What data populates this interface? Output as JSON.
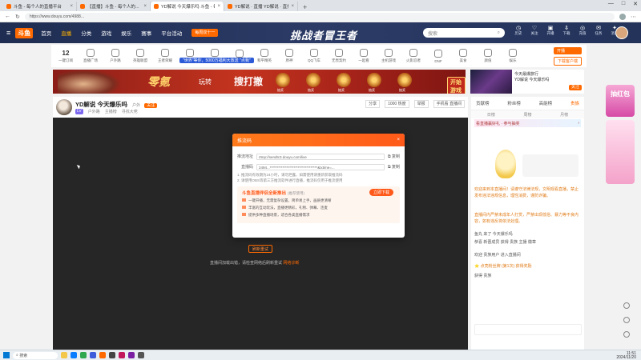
{
  "browser": {
    "tabs": [
      {
        "title": "斗鱼 - 每个人的直播平台",
        "active": false
      },
      {
        "title": "【直播】斗鱼 - 每个人的...",
        "active": false
      },
      {
        "title": "YD解说 今天爆乐吗 斗鱼 - 每个人...",
        "active": true
      },
      {
        "title": "YD解说 · 直播 YD解说 · 直播",
        "active": false
      }
    ],
    "url": "https://www.douyu.com/4988...",
    "window_controls": [
      "—",
      "□",
      "✕"
    ]
  },
  "site": {
    "logo": "斗鱼",
    "nav": [
      "首页",
      "直播",
      "分类",
      "游戏",
      "娱乐",
      "赛事",
      "平台活动"
    ],
    "promo_badge": "每周双十一",
    "slogan": "挑战者冒王者",
    "search_placeholder": "搜索",
    "header_icons": [
      {
        "label": "历史",
        "glyph": "◷"
      },
      {
        "label": "关注",
        "glyph": "♡"
      },
      {
        "label": "开播",
        "glyph": "▣"
      },
      {
        "label": "下载",
        "glyph": "⇩"
      },
      {
        "label": "充值",
        "glyph": "◎"
      },
      {
        "label": "任务",
        "glyph": "✉"
      },
      {
        "label": "消息",
        "glyph": "✦"
      }
    ]
  },
  "category_bar": {
    "number_item": {
      "value": "12",
      "label": "一键订阅"
    },
    "items": [
      "直播广场",
      "户外路",
      "英雄联盟",
      "王者荣耀",
      "穿越火线",
      "绝地求生",
      "CS2",
      "和平精英",
      "原神",
      "QQ飞车",
      "无畏契约",
      "一起看",
      "主机游戏",
      "火影忍者",
      "DNF",
      "美食",
      "颜值",
      "娱乐"
    ],
    "announcement": "\"世界\"等你，5000万福利大放送 \"点我\"",
    "right_buttons": [
      "开播",
      "下载客户端"
    ]
  },
  "banner": {
    "headline": "零氪",
    "middle": "玩转",
    "slogan": "搜打撤",
    "play_button": "开始游戏",
    "gift_labels": [
      "抽奖",
      "抽奖",
      "抽奖",
      "抽奖",
      "抽奖"
    ],
    "right_ad": {
      "title": "今天最爆旅行",
      "subtitle": "YD解说 今天爆乐吗",
      "follow": "关注"
    }
  },
  "room": {
    "title": "YD解说 今天爆乐吗",
    "tag": "户外",
    "follow": "关注",
    "level": "LV",
    "meta": [
      "户外路",
      "主播榜",
      "寻找大佬"
    ],
    "right": [
      "分享",
      "1000 热度",
      "举报",
      "手机看 直播间"
    ]
  },
  "player": {
    "error_button": "刷新重试",
    "error_text": "直播间加载出错，请检查网络后刷新重试",
    "error_link": "网络诊断"
  },
  "sidebar": {
    "tabs": [
      "贡献榜",
      "粉丝榜",
      "高能榜",
      "贵族"
    ],
    "active_tab": 3,
    "subtabs": [
      "日榜",
      "周榜",
      "月榜"
    ],
    "promo_text": "看直播赢好礼 · 参与抽奖",
    "messages": [
      {
        "text": "欢迎来到本直播间！请遵守法律法规，文明观看直播，禁止发布违法违规信息，理性消费，谨防诈骗。",
        "color": "orange"
      },
      {
        "text": "直播间内严禁未成年人打赏，严禁出现低俗、暴力等不良内容，如有违反将依法处理。",
        "color": "orange"
      },
      {
        "text": "鱼丸 来了 今天爆乐吗",
        "color": "gray"
      },
      {
        "text": "恭喜 新晋成员 获得 贵族 主播 徽章",
        "color": "gray"
      },
      {
        "text": "欢迎 贵族用户 进入直播间",
        "color": "gray"
      },
      {
        "text": "⭐ 点亮粉丝牌 (第1次) 获得奖励",
        "color": "orange"
      },
      {
        "text": "获得 贵族",
        "color": "gray"
      }
    ]
  },
  "modal": {
    "title": "推流码",
    "close": "×",
    "rows": [
      {
        "label": "推流地址",
        "value": "rtmp://sendtc3.douyu.com/live",
        "action": "复制"
      },
      {
        "label": "直播码",
        "value": "2494...**********************************&txtime=...",
        "action": "复制"
      }
    ],
    "tips": [
      "1. 推流码有效期为24小时，请勿泄露，如需使用请重新获取推流码",
      "2. 请使用OBS等第三方推流软件进行直播，推流码仅用于推流使用"
    ],
    "obs": {
      "title": "斗鱼直播伴侣全新推出",
      "subtitle": "(推荐使用)",
      "button": "立即下载",
      "items": [
        "一键开播，无需复杂设置，简单易上手，画质更清晰",
        "丰富的互动玩法，直播更精彩，礼物、弹幕、连麦",
        "提供多种直播场景，适合各类直播需求"
      ]
    }
  },
  "taskbar": {
    "search": "搜索",
    "time": "11:51",
    "date": "2024/11/20"
  },
  "right_float": {
    "top_text": "抽红包"
  }
}
